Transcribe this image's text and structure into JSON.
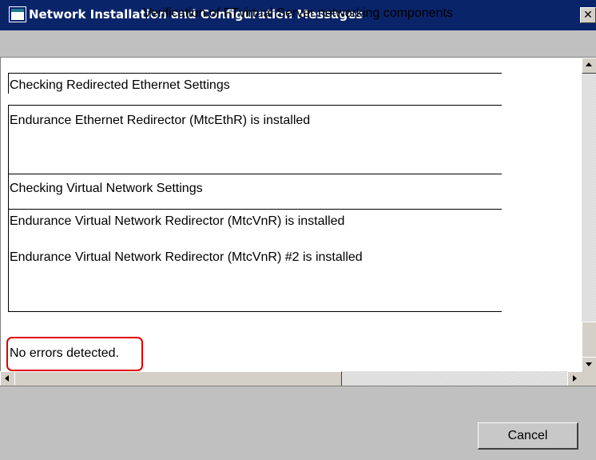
{
  "window": {
    "title": "Network Installation and Configuration Messages",
    "close_glyph": "✕"
  },
  "header": {
    "text": "Verification of FTvirtual Server networking components"
  },
  "messages": {
    "section_ethernet": "Checking Redirected Ethernet Settings",
    "ethernet_installed": "Endurance Ethernet Redirector (MtcEthR) is installed",
    "section_virtual": "Checking Virtual Network Settings",
    "vnr_installed": "Endurance Virtual Network Redirector (MtcVnR) is installed",
    "vnr2_installed": "Endurance Virtual Network Redirector (MtcVnR) #2 is installed",
    "result": "No errors detected."
  },
  "buttons": {
    "cancel": "Cancel"
  },
  "colors": {
    "titlebar": "#0a246a",
    "highlight": "#e00000"
  }
}
